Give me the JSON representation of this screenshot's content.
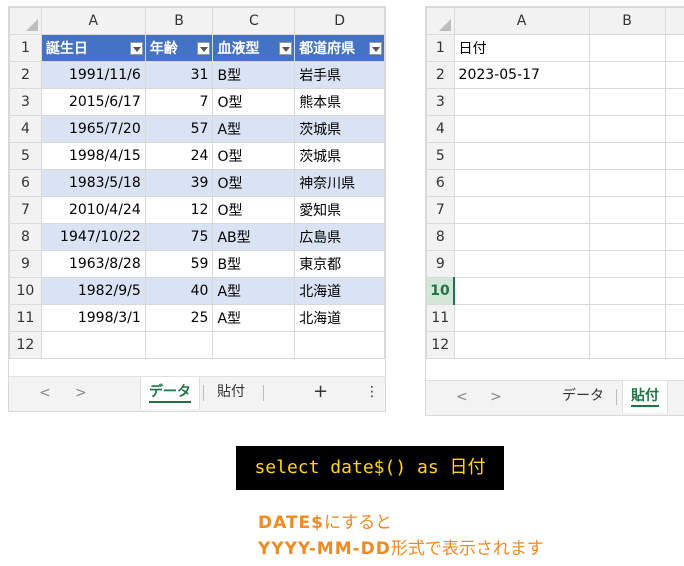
{
  "sheet1": {
    "columns": [
      "A",
      "B",
      "C",
      "D"
    ],
    "headers": [
      "誕生日",
      "年齢",
      "血液型",
      "都道府県"
    ],
    "rows": [
      [
        "1991/11/6",
        "31",
        "B型",
        "岩手県"
      ],
      [
        "2015/6/17",
        "7",
        "O型",
        "熊本県"
      ],
      [
        "1965/7/20",
        "57",
        "A型",
        "茨城県"
      ],
      [
        "1998/4/15",
        "24",
        "O型",
        "茨城県"
      ],
      [
        "1983/5/18",
        "39",
        "O型",
        "神奈川県"
      ],
      [
        "2010/4/24",
        "12",
        "O型",
        "愛知県"
      ],
      [
        "1947/10/22",
        "75",
        "AB型",
        "広島県"
      ],
      [
        "1963/8/28",
        "59",
        "B型",
        "東京都"
      ],
      [
        "1982/9/5",
        "40",
        "A型",
        "北海道"
      ],
      [
        "1998/3/1",
        "25",
        "A型",
        "北海道"
      ]
    ],
    "row_numbers": [
      "1",
      "2",
      "3",
      "4",
      "5",
      "6",
      "7",
      "8",
      "9",
      "10",
      "11",
      "12"
    ],
    "tabs": {
      "prev": "<",
      "next": ">",
      "data": "データ",
      "paste": "貼付",
      "add": "+",
      "more": "⋮"
    }
  },
  "sheet2": {
    "columns": [
      "A",
      "B"
    ],
    "a1": "日付",
    "a2": "2023-05-17",
    "row_numbers": [
      "1",
      "2",
      "3",
      "4",
      "5",
      "6",
      "7",
      "8",
      "9",
      "10",
      "11",
      "12"
    ],
    "tabs": {
      "prev": "<",
      "next": ">",
      "data": "データ",
      "paste": "貼付"
    }
  },
  "sql": "select date$() as 日付",
  "note": {
    "keyword": "DATE$",
    "line1_rest": "にすると",
    "format": "YYYY-MM-DD",
    "line2_rest": "形式で表示されます"
  },
  "colors": {
    "table_header": "#4472c4",
    "band": "#dae3f3",
    "excel_green": "#217346",
    "sql_text": "#ffd51a",
    "note": "#f08a24"
  }
}
